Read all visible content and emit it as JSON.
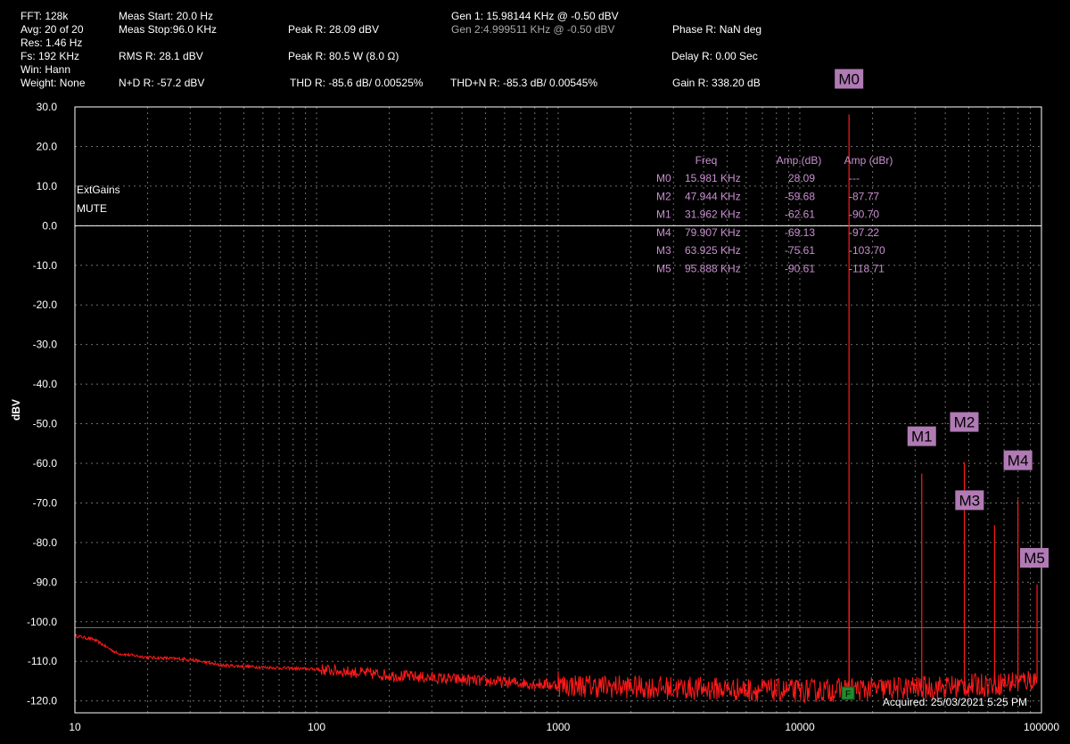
{
  "header": {
    "fft": "FFT: 128k",
    "avg": "Avg: 20 of 20",
    "res": "Res: 1.46 Hz",
    "fs": "Fs: 192 KHz",
    "win": "Win: Hann",
    "weight": "Weight: None",
    "meas_start": "Meas Start: 20.0 Hz",
    "meas_stop": "Meas Stop:96.0 KHz",
    "rms": "RMS R: 28.1 dBV",
    "nd": "N+D R: -57.2 dBV",
    "peak_dbv": "Peak R: 28.09 dBV",
    "peak_w": "Peak R: 80.5 W (8.0 Ω)",
    "thd": "THD R: -85.6 dB/ 0.00525%",
    "gen1": "Gen 1: 15.98144 KHz @ -0.50  dBV",
    "gen2": "Gen 2:4.999511 KHz @ -0.50  dBV",
    "thdn": "THD+N R: -85.3 dB/ 0.00545%",
    "phase": "Phase R: NaN deg",
    "delay": "Delay R: 0.00 Sec",
    "gain": "Gain R: 338.20 dB"
  },
  "colors": {
    "trace": "#ff1a1a",
    "marker_box": "#b07ab4",
    "marker_text": "#c98fd0",
    "grid": "#6e6e6e",
    "frame": "#ffffff"
  },
  "chart_data": {
    "type": "line",
    "xscale": "log",
    "xlim": [
      10,
      100000
    ],
    "ylim": [
      -123,
      30
    ],
    "ylabel": "dBV",
    "x_ticks": [
      "10",
      "100",
      "1000",
      "10000",
      "100000"
    ],
    "y_ticks": [
      "30.0",
      "20.0",
      "10.0",
      "0.0",
      "-10.0",
      "-20.0",
      "-30.0",
      "-40.0",
      "-50.0",
      "-60.0",
      "-70.0",
      "-80.0",
      "-90.0",
      "-100.0",
      "-110.0",
      "-120.0"
    ],
    "reference_lines": [
      0,
      -101.5
    ],
    "annotations": [
      "ExtGains",
      "MUTE"
    ],
    "acquired": "Acquired: 25/03/2021  5:25 PM",
    "f_marker": "F",
    "noise_floor": {
      "x": [
        10,
        12,
        15,
        20,
        30,
        40,
        60,
        100,
        200,
        500,
        1000,
        2000,
        5000,
        10000,
        20000,
        40000,
        70000,
        96000
      ],
      "y": [
        -103.5,
        -104.5,
        -108,
        -109,
        -109.5,
        -111,
        -111.5,
        -112,
        -113.5,
        -115,
        -116,
        -116.5,
        -117,
        -117.5,
        -117,
        -116.5,
        -115.5,
        -114.5
      ]
    },
    "peaks": [
      {
        "x": 15981,
        "y": 28.09
      },
      {
        "x": 31962,
        "y": -62.61
      },
      {
        "x": 47944,
        "y": -59.68
      },
      {
        "x": 63925,
        "y": -75.61
      },
      {
        "x": 79907,
        "y": -69.13
      },
      {
        "x": 95888,
        "y": -90.61
      },
      {
        "x": 1000,
        "y": -112.5
      },
      {
        "x": 16000,
        "y": -92
      }
    ],
    "markers": [
      {
        "label": "M0",
        "x": 15981,
        "y": 28.09
      },
      {
        "label": "M1",
        "x": 31962,
        "y": -62.61
      },
      {
        "label": "M2",
        "x": 47944,
        "y": -59.68
      },
      {
        "label": "M3",
        "x": 63925,
        "y": -75.61
      },
      {
        "label": "M4",
        "x": 79907,
        "y": -69.13
      },
      {
        "label": "M5",
        "x": 95888,
        "y": -90.61
      }
    ],
    "marker_table": {
      "headers": [
        "Freq",
        "Amp.(dB)",
        "Amp (dBr)"
      ],
      "rows": [
        [
          "M0",
          "15.981 KHz",
          "28.09",
          "---"
        ],
        [
          "M2",
          "47.944 KHz",
          "-59.68",
          "-87.77"
        ],
        [
          "M1",
          "31.962 KHz",
          "-62.61",
          "-90.70"
        ],
        [
          "M4",
          "79.907 KHz",
          "-69.13",
          "-97.22"
        ],
        [
          "M3",
          "63.925 KHz",
          "-75.61",
          "-103.70"
        ],
        [
          "M5",
          "95.888 KHz",
          "-90.61",
          "-118.71"
        ]
      ]
    }
  }
}
